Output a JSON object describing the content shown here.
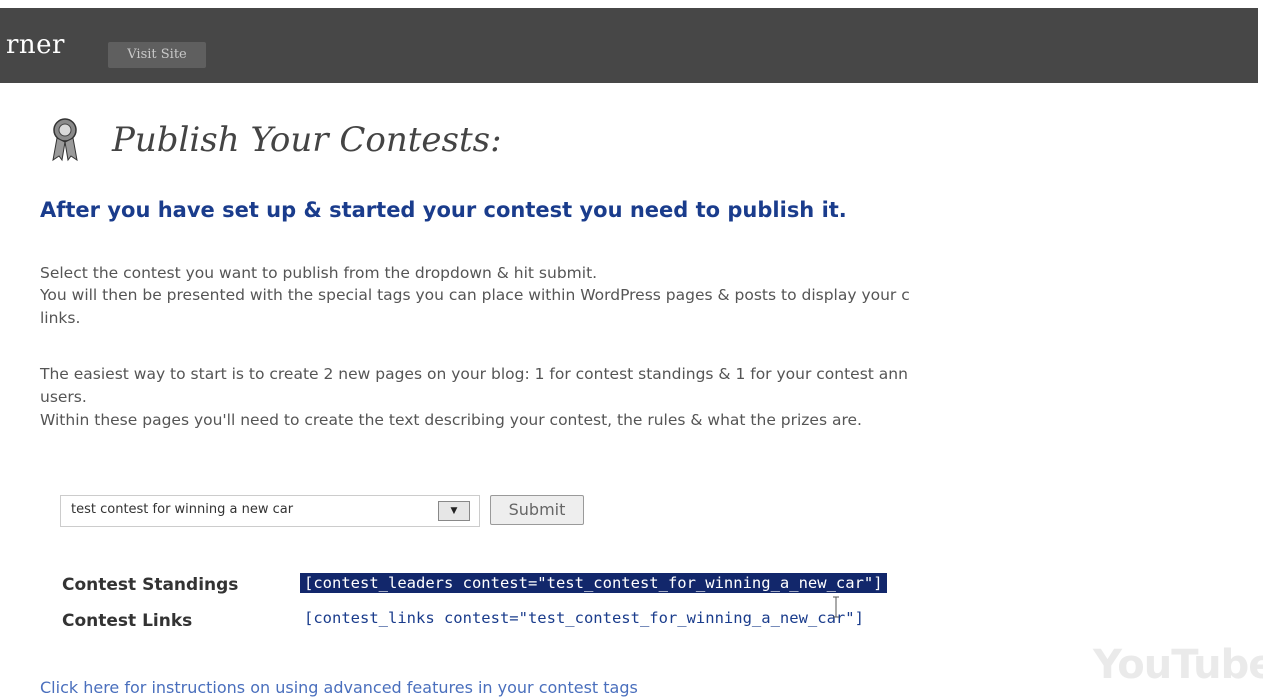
{
  "header": {
    "site_title": "rner",
    "visit_site_label": "Visit Site"
  },
  "page": {
    "title": "Publish Your Contests:",
    "subheading": "After you have set up & started your contest you need to publish it.",
    "paragraphs": [
      "Select the contest you want to publish from the dropdown & hit submit.",
      "You will then be presented with the special tags you can place within WordPress pages & posts to display your c",
      "links.",
      "The easiest way to start is to create 2 new pages on your blog: 1 for contest standings & 1 for your contest ann",
      "users.",
      "Within these pages you'll need to create the text describing your contest, the rules & what the prizes are."
    ]
  },
  "form": {
    "selected_contest": "test contest for winning a new car",
    "submit_label": "Submit"
  },
  "tags": [
    {
      "label": "Contest Standings",
      "code": "[contest_leaders contest=\"test_contest_for_winning_a_new_car\"]"
    },
    {
      "label": "Contest Links",
      "code": "[contest_links contest=\"test_contest_for_winning_a_new_car\"]"
    }
  ],
  "footer": {
    "instructions_link": "Click here for instructions on using advanced features in your contest tags"
  },
  "watermark": "YouTube",
  "colors": {
    "topbar": "#474747",
    "heading_blue": "#1a3c8c",
    "selection": "#12276b",
    "link": "#4a6fbd"
  }
}
